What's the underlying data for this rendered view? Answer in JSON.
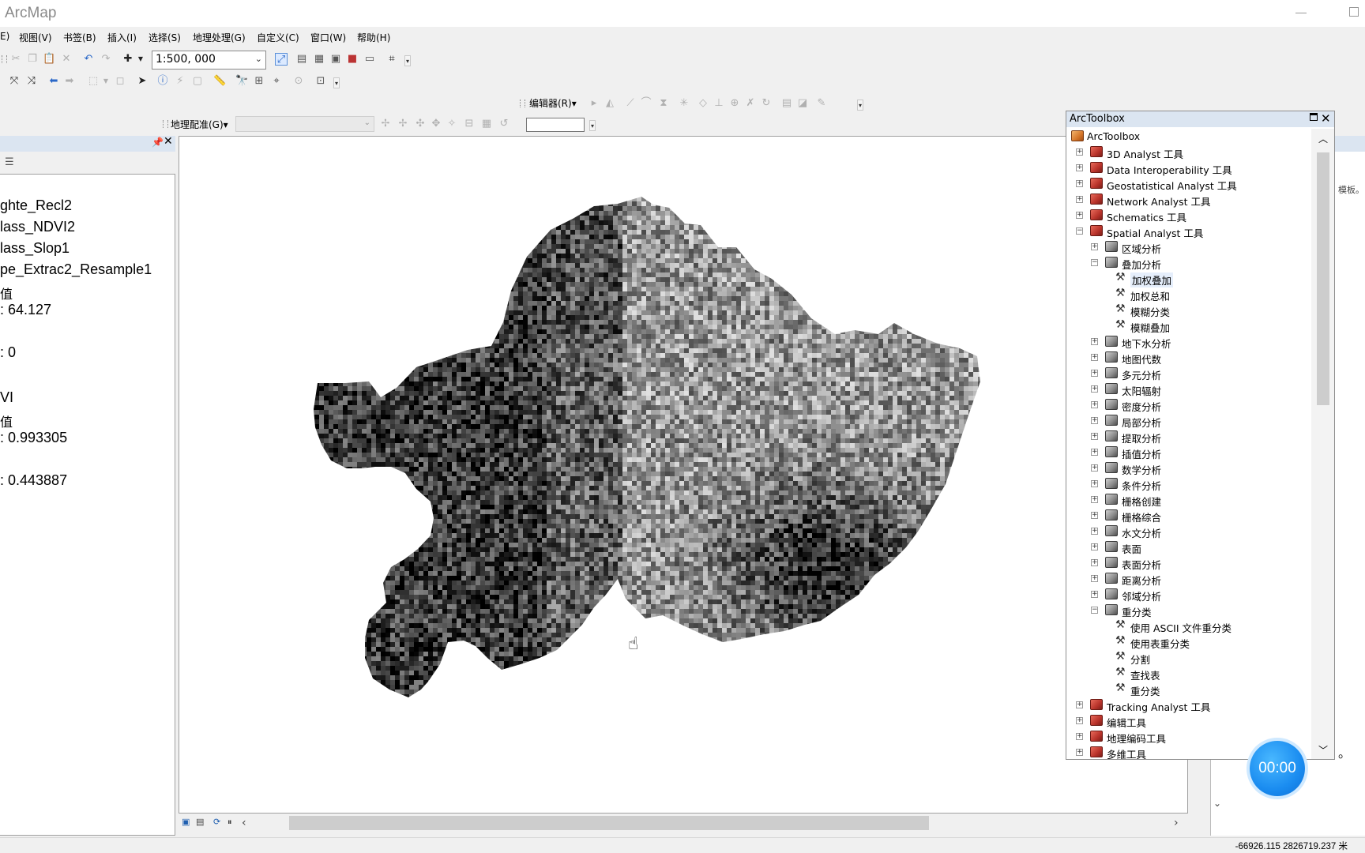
{
  "app": {
    "title": "ArcMap"
  },
  "menus": [
    "E)",
    "视图(V)",
    "书签(B)",
    "插入(I)",
    "选择(S)",
    "地理处理(G)",
    "自定义(C)",
    "窗口(W)",
    "帮助(H)"
  ],
  "standard_toolbar": {
    "scale": "1:500, 000"
  },
  "editor_toolbar": {
    "label": "编辑器(R)▾"
  },
  "georef_toolbar": {
    "label": "地理配准(G)▾"
  },
  "toc": {
    "lines": [
      "ghte_Recl2",
      "lass_NDVI2",
      "lass_Slop1",
      "pe_Extrac2_Resample1",
      "值",
      ": 64.127",
      ": 0",
      "VI",
      "值",
      ": 0.993305",
      ": 0.443887"
    ]
  },
  "arctoolbox": {
    "title": "ArcToolbox",
    "items": [
      {
        "label": "ArcToolbox",
        "level": 0,
        "kind": "root"
      },
      {
        "label": "3D Analyst 工具",
        "level": 1,
        "kind": "toolbox",
        "state": "collapsed"
      },
      {
        "label": "Data Interoperability 工具",
        "level": 1,
        "kind": "toolbox",
        "state": "collapsed"
      },
      {
        "label": "Geostatistical Analyst 工具",
        "level": 1,
        "kind": "toolbox",
        "state": "collapsed"
      },
      {
        "label": "Network Analyst 工具",
        "level": 1,
        "kind": "toolbox",
        "state": "collapsed"
      },
      {
        "label": "Schematics 工具",
        "level": 1,
        "kind": "toolbox",
        "state": "collapsed"
      },
      {
        "label": "Spatial Analyst 工具",
        "level": 1,
        "kind": "toolbox",
        "state": "expanded"
      },
      {
        "label": "区域分析",
        "level": 2,
        "kind": "toolset",
        "state": "collapsed"
      },
      {
        "label": "叠加分析",
        "level": 2,
        "kind": "toolset",
        "state": "expanded"
      },
      {
        "label": "加权叠加",
        "level": 3,
        "kind": "tool",
        "selected": true
      },
      {
        "label": "加权总和",
        "level": 3,
        "kind": "tool"
      },
      {
        "label": "模糊分类",
        "level": 3,
        "kind": "tool"
      },
      {
        "label": "模糊叠加",
        "level": 3,
        "kind": "tool"
      },
      {
        "label": "地下水分析",
        "level": 2,
        "kind": "toolset",
        "state": "collapsed"
      },
      {
        "label": "地图代数",
        "level": 2,
        "kind": "toolset",
        "state": "collapsed"
      },
      {
        "label": "多元分析",
        "level": 2,
        "kind": "toolset",
        "state": "collapsed"
      },
      {
        "label": "太阳辐射",
        "level": 2,
        "kind": "toolset",
        "state": "collapsed"
      },
      {
        "label": "密度分析",
        "level": 2,
        "kind": "toolset",
        "state": "collapsed"
      },
      {
        "label": "局部分析",
        "level": 2,
        "kind": "toolset",
        "state": "collapsed"
      },
      {
        "label": "提取分析",
        "level": 2,
        "kind": "toolset",
        "state": "collapsed"
      },
      {
        "label": "插值分析",
        "level": 2,
        "kind": "toolset",
        "state": "collapsed"
      },
      {
        "label": "数学分析",
        "level": 2,
        "kind": "toolset",
        "state": "collapsed"
      },
      {
        "label": "条件分析",
        "level": 2,
        "kind": "toolset",
        "state": "collapsed"
      },
      {
        "label": "栅格创建",
        "level": 2,
        "kind": "toolset",
        "state": "collapsed"
      },
      {
        "label": "栅格综合",
        "level": 2,
        "kind": "toolset",
        "state": "collapsed"
      },
      {
        "label": "水文分析",
        "level": 2,
        "kind": "toolset",
        "state": "collapsed"
      },
      {
        "label": "表面",
        "level": 2,
        "kind": "toolset",
        "state": "collapsed"
      },
      {
        "label": "表面分析",
        "level": 2,
        "kind": "toolset",
        "state": "collapsed"
      },
      {
        "label": "距离分析",
        "level": 2,
        "kind": "toolset",
        "state": "collapsed"
      },
      {
        "label": "邻域分析",
        "level": 2,
        "kind": "toolset",
        "state": "collapsed"
      },
      {
        "label": "重分类",
        "level": 2,
        "kind": "toolset",
        "state": "expanded"
      },
      {
        "label": "使用 ASCII 文件重分类",
        "level": 3,
        "kind": "tool"
      },
      {
        "label": "使用表重分类",
        "level": 3,
        "kind": "tool"
      },
      {
        "label": "分割",
        "level": 3,
        "kind": "tool"
      },
      {
        "label": "查找表",
        "level": 3,
        "kind": "tool"
      },
      {
        "label": "重分类",
        "level": 3,
        "kind": "tool"
      },
      {
        "label": "Tracking Analyst 工具",
        "level": 1,
        "kind": "toolbox",
        "state": "collapsed"
      },
      {
        "label": "编辑工具",
        "level": 1,
        "kind": "toolbox",
        "state": "collapsed"
      },
      {
        "label": "地理编码工具",
        "level": 1,
        "kind": "toolbox",
        "state": "collapsed"
      },
      {
        "label": "多维工具",
        "level": 1,
        "kind": "toolbox",
        "state": "collapsed"
      }
    ]
  },
  "right_panel": {
    "fragment": "模板。",
    "fragment2": "。"
  },
  "timer": "00:00",
  "status": {
    "coords": "-66926.115  2826719.237 米"
  }
}
